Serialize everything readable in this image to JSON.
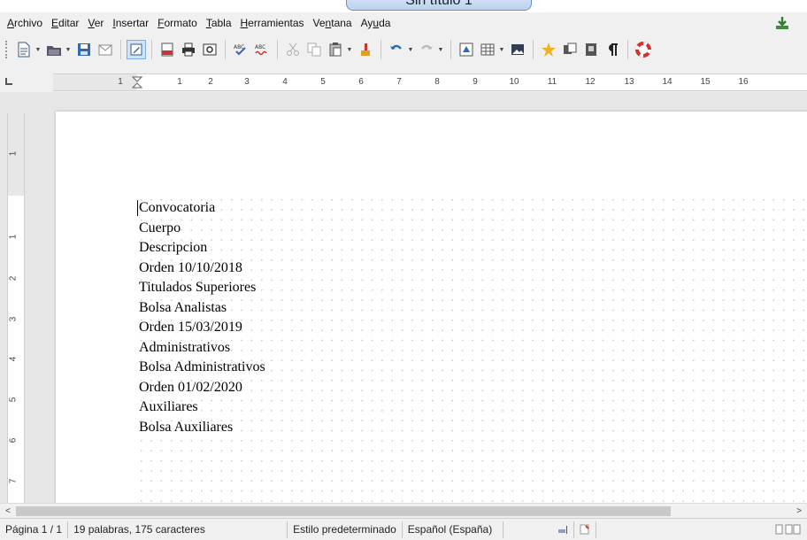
{
  "window": {
    "title": "Sin título 1"
  },
  "menubar": {
    "items": [
      {
        "pre": "",
        "u": "A",
        "post": "rchivo"
      },
      {
        "pre": "",
        "u": "E",
        "post": "ditar"
      },
      {
        "pre": "",
        "u": "V",
        "post": "er"
      },
      {
        "pre": "",
        "u": "I",
        "post": "nsertar"
      },
      {
        "pre": "",
        "u": "F",
        "post": "ormato"
      },
      {
        "pre": "",
        "u": "T",
        "post": "abla"
      },
      {
        "pre": "",
        "u": "H",
        "post": "erramientas"
      },
      {
        "pre": "Ve",
        "u": "n",
        "post": "tana"
      },
      {
        "pre": "Ay",
        "u": "u",
        "post": "da"
      }
    ]
  },
  "ruler": {
    "h_labels": [
      "1",
      "1",
      "2",
      "3",
      "4",
      "5",
      "6",
      "7",
      "8",
      "9",
      "10",
      "11",
      "12",
      "13",
      "14",
      "15",
      "16"
    ],
    "v_labels": [
      "1",
      "1",
      "2",
      "3",
      "4",
      "5",
      "6",
      "7"
    ]
  },
  "document": {
    "lines": [
      "Convocatoria",
      "Cuerpo",
      "Descripcion",
      "Orden 10/10/2018",
      "Titulados Superiores",
      "Bolsa Analistas",
      "Orden 15/03/2019",
      "Administrativos",
      "Bolsa Administrativos",
      "Orden 01/02/2020",
      "Auxiliares",
      "Bolsa Auxiliares"
    ]
  },
  "scrollbar": {
    "left_arrow": "<",
    "right_arrow": ">"
  },
  "statusbar": {
    "page": "Página 1 / 1",
    "words": "19 palabras, 175 caracteres",
    "style": "Estilo predeterminado",
    "language": "Español (España)"
  },
  "colors": {
    "accent": "#7eaedc",
    "page": "#ffffff",
    "chrome": "#f0f0f0"
  }
}
